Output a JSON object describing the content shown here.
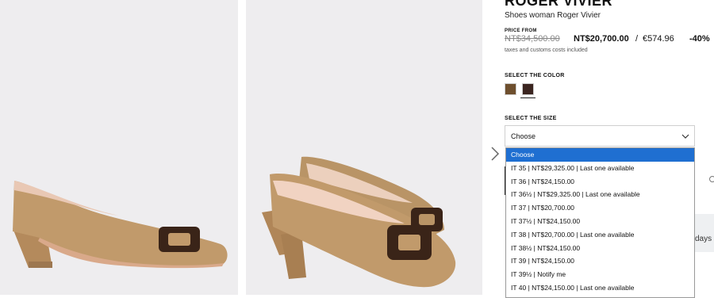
{
  "product": {
    "brand": "ROGER VIVIER",
    "subtitle": "Shoes woman Roger Vivier",
    "price_label": "PRICE FROM",
    "old_price": "NT$34,500.00",
    "new_price": "NT$20,700.00",
    "separator": "/",
    "eur_price": "€574.96",
    "discount": "-40%",
    "taxes_note": "taxes and customs costs included"
  },
  "color_section": {
    "label": "SELECT THE COLOR",
    "swatches": [
      {
        "name": "tan",
        "color": "#6e4f2e"
      },
      {
        "name": "dark-brown",
        "color": "#3b2520",
        "selected": true
      }
    ]
  },
  "size_section": {
    "label": "SELECT THE SIZE",
    "selected_value": "Choose",
    "options": [
      "Choose",
      "IT 35 | NT$29,325.00 | Last one available",
      "IT 36 | NT$24,150.00",
      "IT 36½ | NT$29,325.00 | Last one available",
      "IT 37 | NT$20,700.00",
      "IT 37½ | NT$24,150.00",
      "IT 38 | NT$20,700.00 | Last one available",
      "IT 38½ | NT$24,150.00",
      "IT 39 | NT$24,150.00",
      "IT 39½ | Notify me",
      "IT 40 | NT$24,150.00 | Last one available"
    ]
  },
  "partial_text": "days t",
  "colors": {
    "image_bg": "#eeedef",
    "shoe_suede": "#c19a6b",
    "buckle": "#3a2418",
    "dropdown_highlight": "#1f6fd1"
  }
}
